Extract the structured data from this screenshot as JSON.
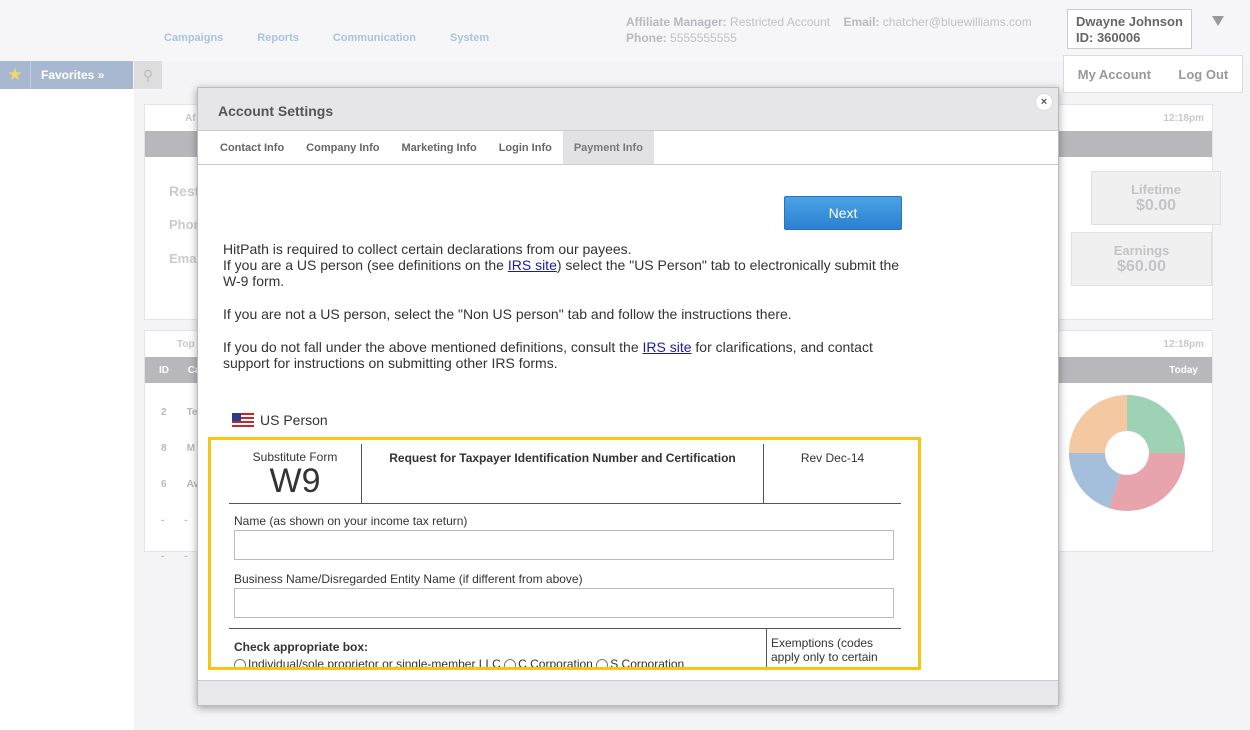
{
  "nav": [
    "Campaigns",
    "Reports",
    "Communication",
    "System"
  ],
  "affiliate": {
    "manager_label": "Affiliate Manager:",
    "manager_value": "Restricted Account",
    "email_label": "Email:",
    "email_value": "chatcher@bluewilliams.com",
    "phone_label": "Phone:",
    "phone_value": "5555555555"
  },
  "user": {
    "name": "Dwayne Johnson",
    "id": "ID: 360006"
  },
  "account_menu": {
    "my_account": "My Account",
    "logout": "Log Out"
  },
  "favorites": {
    "label": "Favorites »"
  },
  "background": {
    "panel1_header_left": "Af",
    "panel1_time": "12:18pm",
    "rest_label": "Rest",
    "phone_label": "Phon",
    "email_label": "Emai",
    "lifetime_label": "Lifetime",
    "lifetime_value": "$0.00",
    "earnings_label": "Earnings",
    "earnings_value": "$60.00",
    "panel2_header_left": "Top",
    "panel2_time": "12:18pm",
    "col_id": "ID",
    "col_ca": "Ca",
    "col_today": "Today",
    "rows": [
      {
        "id": "2",
        "name": "Te"
      },
      {
        "id": "8",
        "name": "M"
      },
      {
        "id": "6",
        "name": "Av"
      },
      {
        "id": "-",
        "name": "-"
      },
      {
        "id": "-",
        "name": "-"
      }
    ]
  },
  "modal": {
    "title": "Account Settings",
    "close": "×",
    "tabs": [
      "Contact Info",
      "Company Info",
      "Marketing Info",
      "Login Info",
      "Payment Info"
    ],
    "active_tab": "Payment Info",
    "next_button": "Next",
    "intro": {
      "p1_line1": "HitPath is required to collect certain declarations from our payees.",
      "p1_line2_before": "If you are a US person (see definitions on the ",
      "irs_link": "IRS site",
      "p1_line2_after": ") select the \"US Person\" tab to electronically submit the W-9 form.",
      "p2": "If you are not a US person, select the \"Non US person\"  tab and follow the instructions there.",
      "p3_before": "If you do not fall under the above mentioned definitions, consult the ",
      "p3_after": " for clarifications, and contact support for instructions on submitting other IRS forms."
    },
    "us_person_label": "US Person",
    "w9": {
      "substitute_form": "Substitute Form",
      "form_name": "W9",
      "title": "Request for Taxpayer Identification Number and Certification",
      "revision": "Rev Dec-14",
      "name_label": "Name (as shown on your income tax return)",
      "name_value": "",
      "business_label": "Business Name/Disregarded Entity Name (if different from above)",
      "business_value": "",
      "check_box_label": "Check appropriate box:",
      "options": [
        "Individual/sole proprietor or single-member LLC",
        "C Corporation",
        "S Corporation"
      ],
      "exemptions_text": "Exemptions (codes apply only to certain"
    }
  },
  "colors": {
    "accent": "#2b80cf",
    "highlight": "#f5c518",
    "donut": [
      "#9ed2b4",
      "#e8a4ac",
      "#a4bfdc",
      "#f4c8a0"
    ]
  }
}
